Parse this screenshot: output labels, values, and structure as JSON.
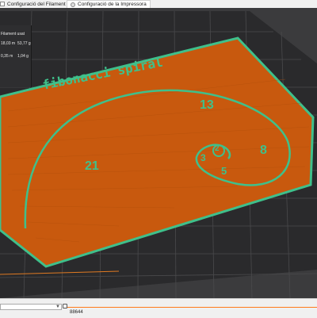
{
  "tabs": [
    {
      "label": "Configuració del Filament",
      "icon": "filament-icon"
    },
    {
      "label": "Configuració de la Impressora",
      "icon": "printer-gear-icon"
    }
  ],
  "info_panel": {
    "title": "Filament usat",
    "length_m": "18,03 m",
    "weight_g": "53,77 g",
    "tower_length": "0,35 m",
    "tower_weight": "1,04 g"
  },
  "model": {
    "title": "fibonacci spiral",
    "labels": [
      "13",
      "21",
      "8",
      "3",
      "2",
      "5"
    ]
  },
  "bottom": {
    "layer_value": "88644"
  },
  "colors": {
    "plate": "#c8590e",
    "text_green": "#3fc08b",
    "bed_dark": "#2a2a2c",
    "slider_accent": "#ff7a1a"
  }
}
